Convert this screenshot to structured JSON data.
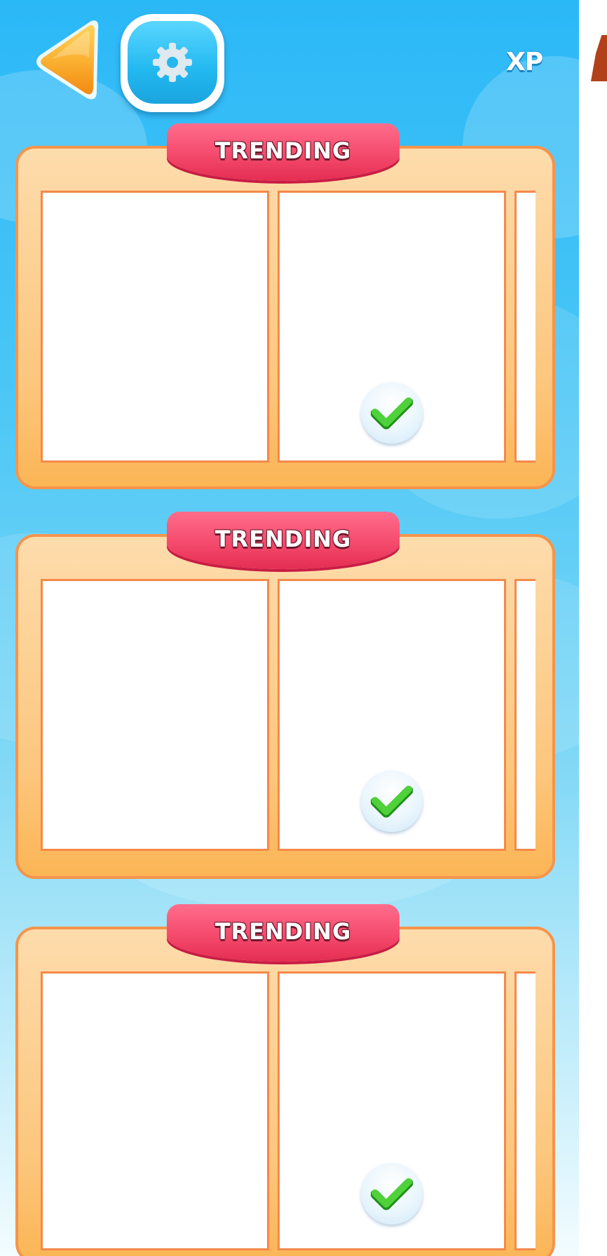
{
  "header": {
    "back_icon": "back-arrow-icon",
    "settings_icon": "gear-icon",
    "xp_label": "XP"
  },
  "cards": [
    {
      "banner_label": "TRENDING",
      "check_icon": "checkmark-icon",
      "checked_slot": 2
    },
    {
      "banner_label": "TRENDING",
      "check_icon": "checkmark-icon",
      "checked_slot": 2
    },
    {
      "banner_label": "TRENDING",
      "check_icon": "checkmark-icon",
      "checked_slot": 2
    }
  ],
  "colors": {
    "sky_top": "#2bb8f7",
    "card_border": "#f5944c",
    "banner": "#f44a6c",
    "settings": "#22b8f0",
    "back_arrow": "#f9a825",
    "check": "#3ec22e"
  }
}
